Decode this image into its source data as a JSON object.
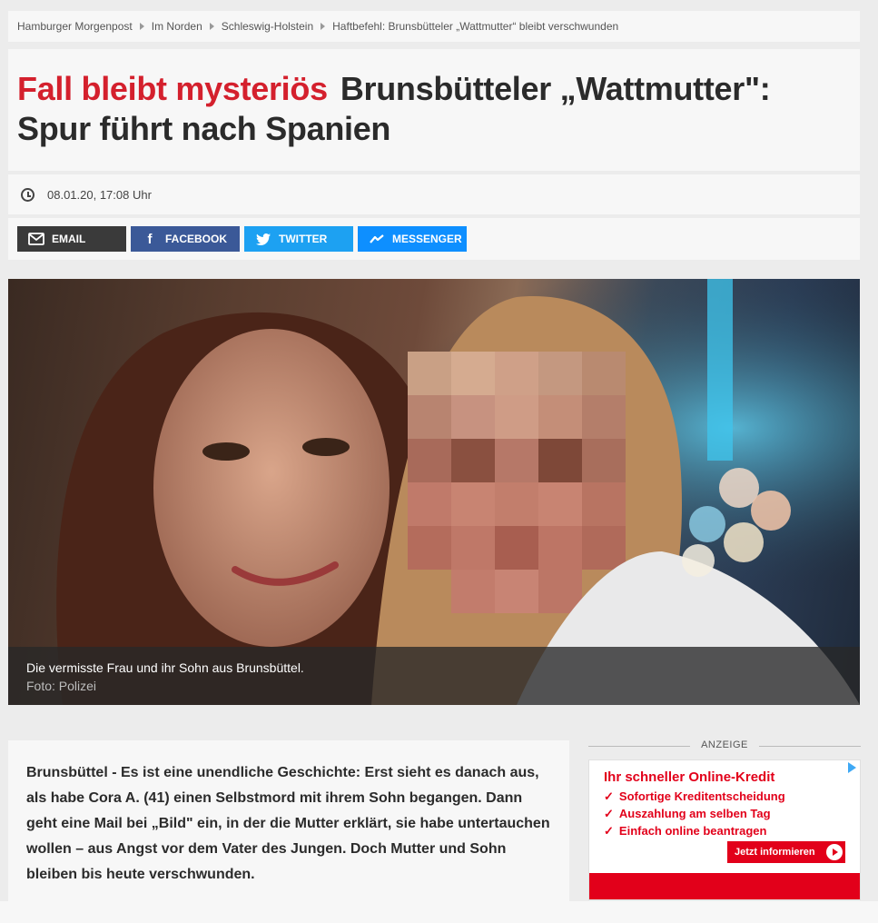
{
  "breadcrumb": {
    "items": [
      "Hamburger Morgenpost",
      "Im Norden",
      "Schleswig-Holstein",
      "Haftbefehl: Brunsbütteler „Wattmutter“ bleibt verschwunden"
    ]
  },
  "headline": {
    "kicker": "Fall bleibt mysteriös",
    "title": "Brunsbütteler „Wattmutter\": Spur führt nach Spanien"
  },
  "meta": {
    "datetime": "08.01.20, 17:08 Uhr",
    "icon": "clock-icon"
  },
  "share": {
    "email": {
      "label": "EMAIL",
      "icon": "envelope-icon",
      "color": "#3a3a3a"
    },
    "facebook": {
      "label": "FACEBOOK",
      "icon": "facebook-icon",
      "color": "#3b5998"
    },
    "twitter": {
      "label": "TWITTER",
      "icon": "twitter-bird-icon",
      "color": "#1da1f2"
    },
    "messenger": {
      "label": "MESSENGER",
      "icon": "messenger-icon",
      "color": "#0e8fff"
    }
  },
  "photo": {
    "caption": "Die vermisste Frau und ihr Sohn aus Brunsbüttel.",
    "credit": "Foto: Polizei"
  },
  "article": {
    "lead": "Brunsbüttel - Es ist eine unendliche Geschichte: Erst sieht es danach aus, als habe Cora A. (41) einen Selbstmord mit ihrem Sohn begangen. Dann geht eine Mail bei „Bild\" ein, in der die Mutter erklärt, sie habe untertauchen wollen – aus Angst vor dem Vater des Jungen. Doch Mutter und Sohn bleiben bis heute verschwunden."
  },
  "ad": {
    "label": "ANZEIGE",
    "title": "Ihr schneller Online-Kredit",
    "bullets": [
      "Sofortige Kreditentscheidung",
      "Auszahlung am selben Tag",
      "Einfach online beantragen"
    ],
    "cta": "Jetzt informieren",
    "accent": "#e2001a"
  }
}
